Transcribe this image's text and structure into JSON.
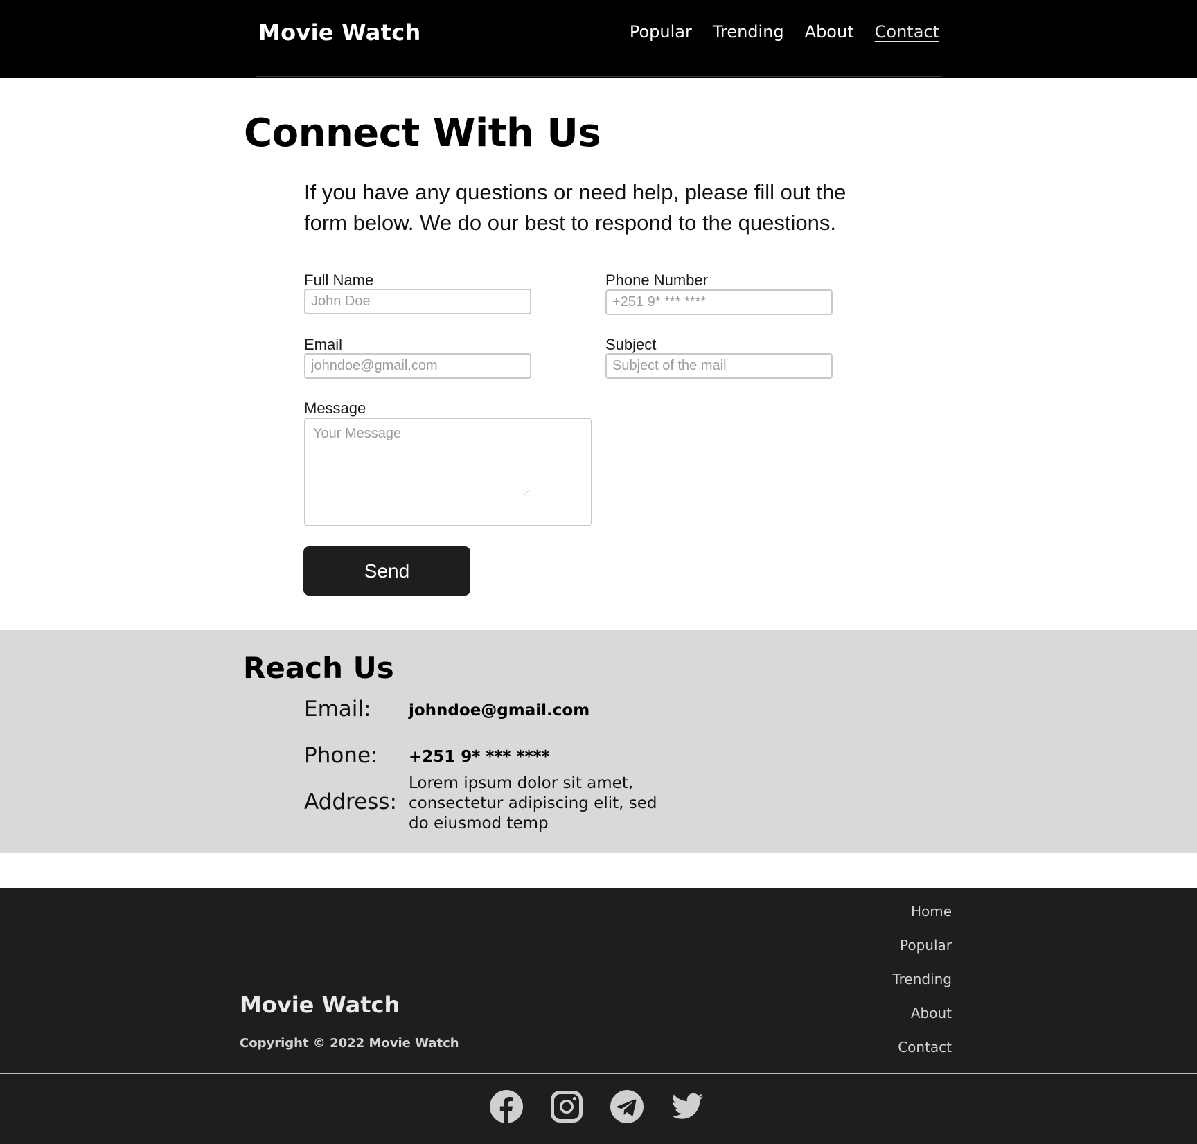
{
  "header": {
    "brand": "Movie Watch",
    "nav": [
      "Popular",
      "Trending",
      "About",
      "Contact"
    ],
    "active_nav": "Contact"
  },
  "connect": {
    "title": "Connect With Us",
    "intro": "If you have any questions or need help, please fill out the form below. We do our best to respond to the questions.",
    "form": {
      "full_name": {
        "label": "Full Name",
        "placeholder": "John Doe"
      },
      "phone": {
        "label": "Phone Number",
        "placeholder": "+251 9* *** ****"
      },
      "email": {
        "label": "Email",
        "placeholder": "johndoe@gmail.com"
      },
      "subject": {
        "label": "Subject",
        "placeholder": "Subject of the mail"
      },
      "message": {
        "label": "Message",
        "placeholder": "Your Message"
      },
      "send_label": "Send"
    }
  },
  "reach": {
    "title": "Reach Us",
    "email_label": "Email:",
    "email_value": "johndoe@gmail.com",
    "phone_label": "Phone:",
    "phone_value": "+251 9* *** ****",
    "address_label": "Address:",
    "address_value": "Lorem ipsum dolor sit amet, consectetur adipiscing elit, sed do eiusmod temp"
  },
  "footer": {
    "brand": "Movie Watch",
    "copyright": "Copyright © 2022 Movie Watch",
    "links": [
      "Home",
      "Popular",
      "Trending",
      "About",
      "Contact"
    ],
    "socials": [
      "facebook-icon",
      "instagram-icon",
      "telegram-icon",
      "twitter-icon"
    ]
  },
  "colors": {
    "header_bg": "#000000",
    "reach_bg": "#d9d9d9",
    "footer_bg": "#1e1e1e",
    "button_bg": "#1e1e1e",
    "social_icon": "#cfcfcf"
  }
}
